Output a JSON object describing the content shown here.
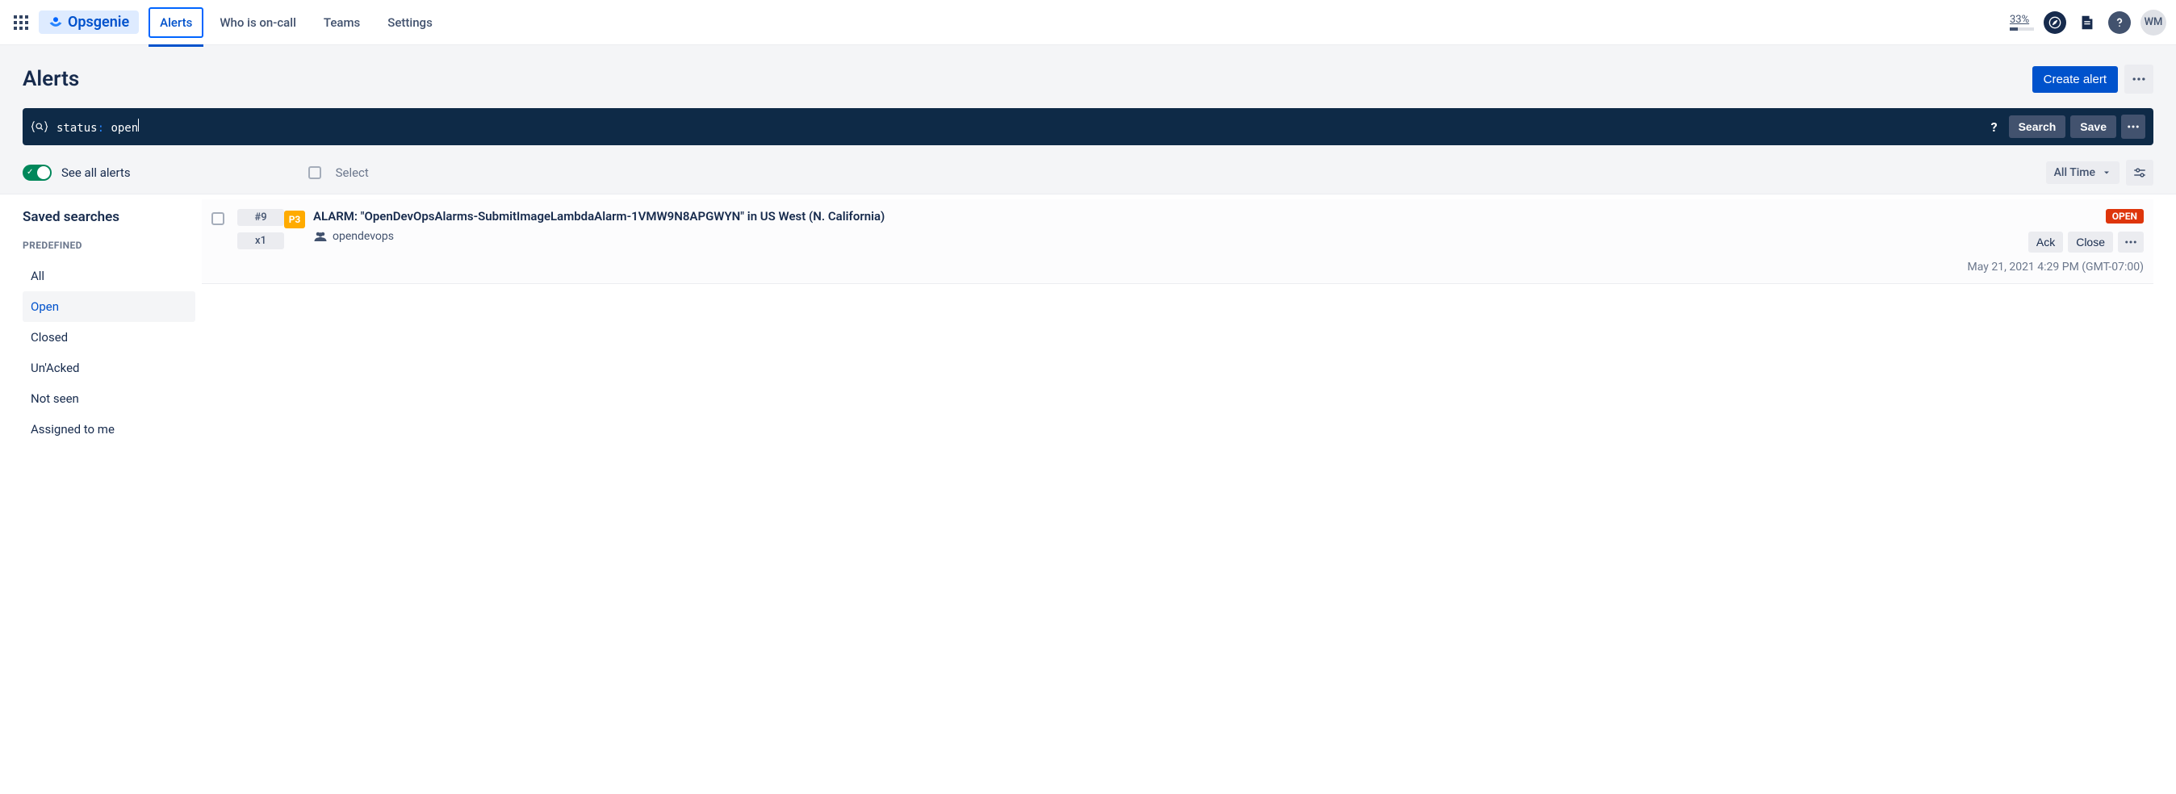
{
  "brand": "Opsgenie",
  "nav": {
    "tabs": [
      "Alerts",
      "Who is on-call",
      "Teams",
      "Settings"
    ],
    "active": 0,
    "percent": "33%",
    "avatar": "WM"
  },
  "page": {
    "title": "Alerts",
    "create_btn": "Create alert"
  },
  "search": {
    "query_key": "status",
    "query_val": "open",
    "search_btn": "Search",
    "save_btn": "Save"
  },
  "toolbar": {
    "toggle_label": "See all alerts",
    "select_label": "Select",
    "time_filter": "All Time"
  },
  "sidebar": {
    "title": "Saved searches",
    "section_label": "PREDEFINED",
    "items": [
      "All",
      "Open",
      "Closed",
      "Un'Acked",
      "Not seen",
      "Assigned to me"
    ],
    "active": 1
  },
  "alerts": [
    {
      "number": "#9",
      "count": "x1",
      "priority": "P3",
      "title": "ALARM: \"OpenDevOpsAlarms-SubmitImageLambdaAlarm-1VMW9N8APGWYN\" in US West (N. California)",
      "team": "opendevops",
      "status": "OPEN",
      "ack_btn": "Ack",
      "close_btn": "Close",
      "timestamp": "May 21, 2021 4:29 PM (GMT-07:00)"
    }
  ]
}
